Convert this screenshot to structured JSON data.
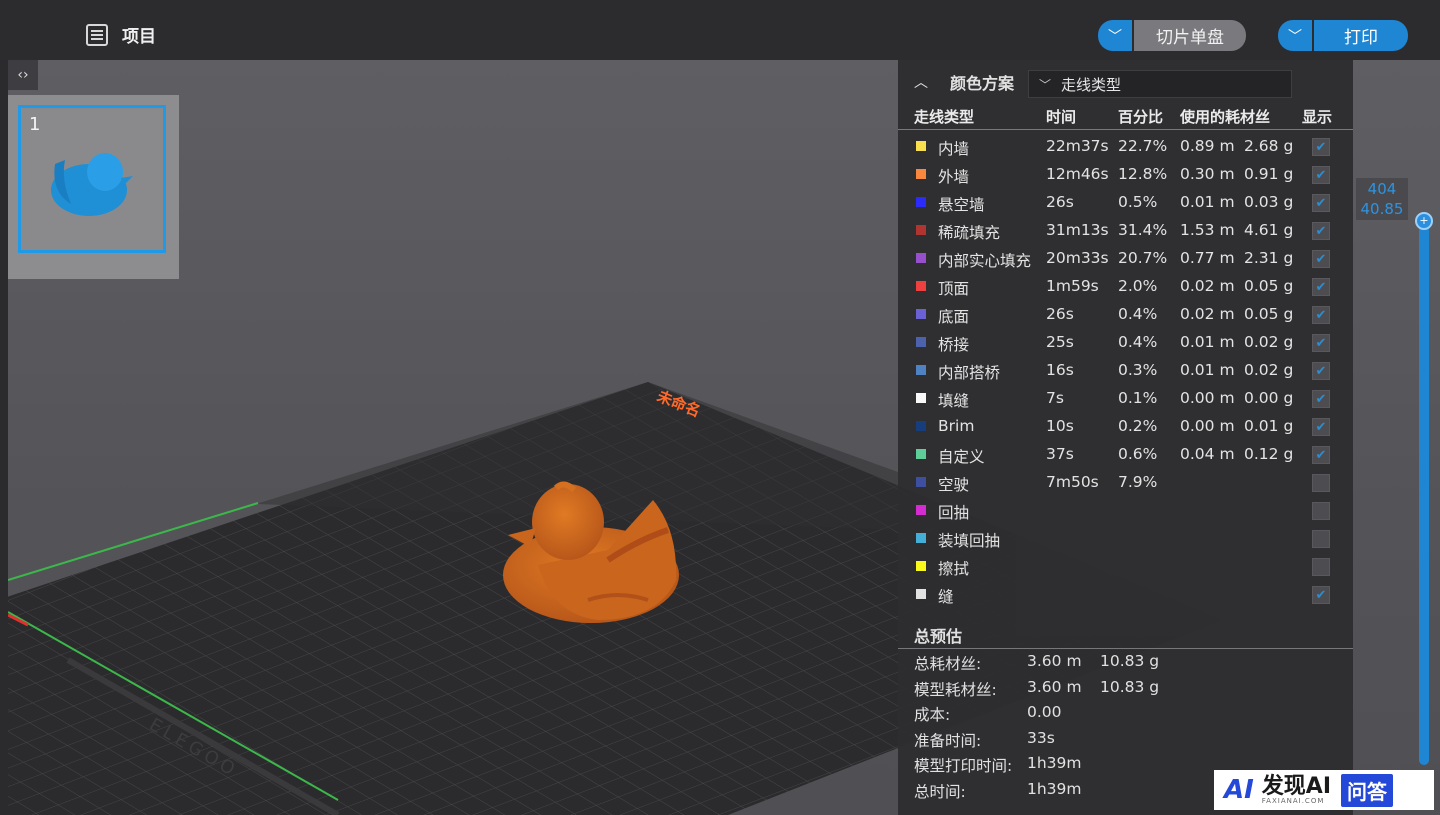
{
  "header": {
    "project_label": "项目",
    "slice_button": "切片单盘",
    "print_button": "打印"
  },
  "plate": {
    "number": "1",
    "bed_label": "未命名",
    "brand_text": "ELEGOO"
  },
  "panel": {
    "title": "颜色方案",
    "selected_scheme": "走线类型",
    "columns": [
      "走线类型",
      "时间",
      "百分比",
      "使用的耗材丝",
      "显示"
    ],
    "rows": [
      {
        "color": "#ffe34d",
        "name": "内墙",
        "time": "22m37s",
        "percent": "22.7%",
        "length": "0.89 m",
        "weight": "2.68 g",
        "shown": true
      },
      {
        "color": "#ff8a3d",
        "name": "外墙",
        "time": "12m46s",
        "percent": "12.8%",
        "length": "0.30 m",
        "weight": "0.91 g",
        "shown": true
      },
      {
        "color": "#2b2bff",
        "name": "悬空墙",
        "time": "26s",
        "percent": "0.5%",
        "length": "0.01 m",
        "weight": "0.03 g",
        "shown": true
      },
      {
        "color": "#b3332f",
        "name": "稀疏填充",
        "time": "31m13s",
        "percent": "31.4%",
        "length": "1.53 m",
        "weight": "4.61 g",
        "shown": true
      },
      {
        "color": "#9a4fd0",
        "name": "内部实心填充",
        "time": "20m33s",
        "percent": "20.7%",
        "length": "0.77 m",
        "weight": "2.31 g",
        "shown": true
      },
      {
        "color": "#f2403f",
        "name": "顶面",
        "time": "1m59s",
        "percent": "2.0%",
        "length": "0.02 m",
        "weight": "0.05 g",
        "shown": true
      },
      {
        "color": "#6b63d8",
        "name": "底面",
        "time": "26s",
        "percent": "0.4%",
        "length": "0.02 m",
        "weight": "0.05 g",
        "shown": true
      },
      {
        "color": "#4d63b0",
        "name": "桥接",
        "time": "25s",
        "percent": "0.4%",
        "length": "0.01 m",
        "weight": "0.02 g",
        "shown": true
      },
      {
        "color": "#4f84c7",
        "name": "内部搭桥",
        "time": "16s",
        "percent": "0.3%",
        "length": "0.01 m",
        "weight": "0.02 g",
        "shown": true
      },
      {
        "color": "#ffffff",
        "name": "填缝",
        "time": "7s",
        "percent": "0.1%",
        "length": "0.00 m",
        "weight": "0.00 g",
        "shown": true
      },
      {
        "color": "#153e7e",
        "name": "Brim",
        "time": "10s",
        "percent": "0.2%",
        "length": "0.00 m",
        "weight": "0.01 g",
        "shown": true
      },
      {
        "color": "#5fd39a",
        "name": "自定义",
        "time": "37s",
        "percent": "0.6%",
        "length": "0.04 m",
        "weight": "0.12 g",
        "shown": true
      },
      {
        "color": "#3e4fa3",
        "name": "空驶",
        "time": "7m50s",
        "percent": "7.9%",
        "length": "",
        "weight": "",
        "shown": false
      },
      {
        "color": "#d92dd6",
        "name": "回抽",
        "time": "",
        "percent": "",
        "length": "",
        "weight": "",
        "shown": false
      },
      {
        "color": "#45b3dc",
        "name": "装填回抽",
        "time": "",
        "percent": "",
        "length": "",
        "weight": "",
        "shown": false
      },
      {
        "color": "#ffff1a",
        "name": "擦拭",
        "time": "",
        "percent": "",
        "length": "",
        "weight": "",
        "shown": false
      },
      {
        "color": "#e8e8e8",
        "name": "缝",
        "time": "",
        "percent": "",
        "length": "",
        "weight": "",
        "shown": true
      }
    ],
    "summary_title": "总预估",
    "summary": [
      {
        "label": "总耗材丝:",
        "v1": "3.60 m",
        "v2": "10.83 g"
      },
      {
        "label": "模型耗材丝:",
        "v1": "3.60 m",
        "v2": "10.83 g"
      },
      {
        "label": "成本:",
        "v1": "0.00",
        "v2": ""
      },
      {
        "label": "准备时间:",
        "v1": "33s",
        "v2": ""
      },
      {
        "label": "模型打印时间:",
        "v1": "1h39m",
        "v2": ""
      },
      {
        "label": "总时间:",
        "v1": "1h39m",
        "v2": ""
      }
    ]
  },
  "layer_slider": {
    "layer": "404",
    "height": "40.85"
  },
  "watermark": {
    "logo": "AI",
    "title": "发现AI",
    "subtitle": "FAXIANAI.COM",
    "badge": "问答"
  },
  "colors": {
    "accent": "#1f86d4",
    "model": "#d0701e"
  }
}
